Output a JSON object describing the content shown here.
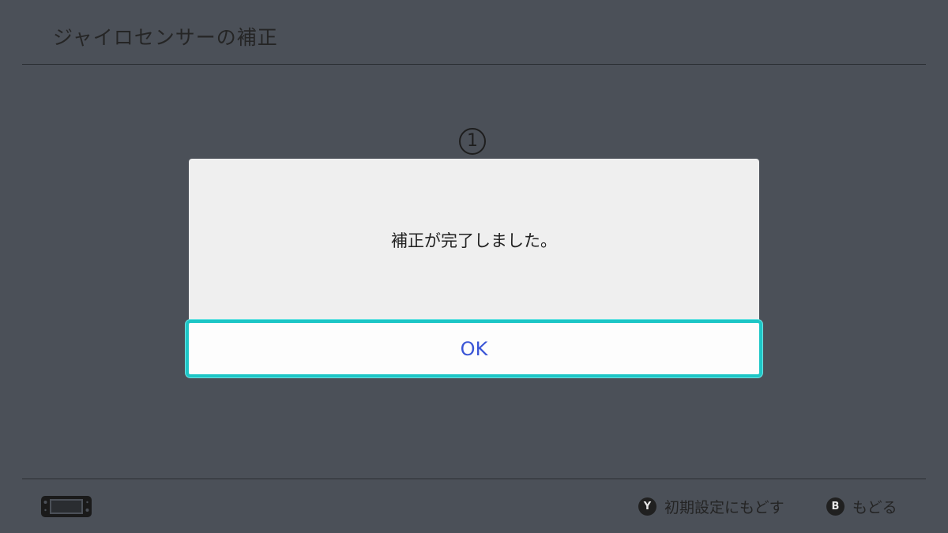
{
  "header": {
    "title": "ジャイロセンサーの補正"
  },
  "step": {
    "marker": "①"
  },
  "dialog": {
    "message": "補正が完了しました。",
    "ok_label": "OK"
  },
  "footer": {
    "device_icon": "console-handheld-icon",
    "hints": [
      {
        "badge": "Y",
        "label": "初期設定にもどす"
      },
      {
        "badge": "B",
        "label": "もどる"
      }
    ]
  },
  "colors": {
    "background": "#4b5058",
    "dialog": "#efefef",
    "focus_border": "#1dc6c6",
    "ok_text": "#3a55d6"
  }
}
